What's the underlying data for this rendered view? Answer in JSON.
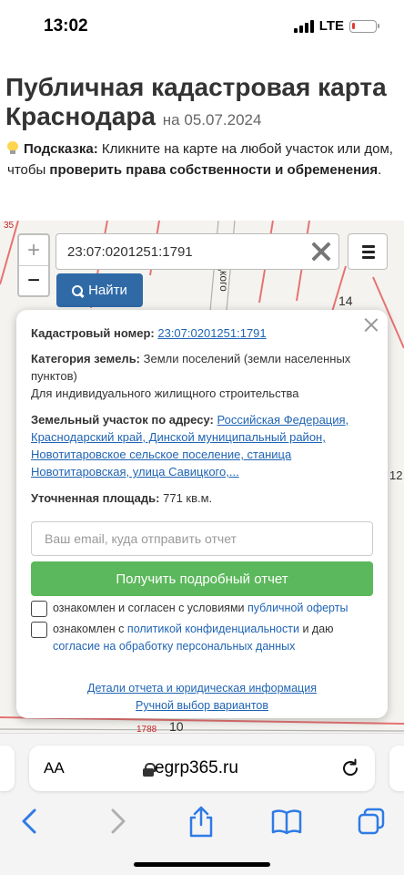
{
  "status_bar": {
    "time": "13:02",
    "network": "LTE",
    "battery_level": 0.15
  },
  "page": {
    "title": "Публичная кадастровая карта Краснодара",
    "date": "на 05.07.2024",
    "hint_label": "Подсказка:",
    "hint_text": "Кликните на карте на любой участок или дом, чтобы",
    "hint_bold": "проверить права собственности и обременения",
    "hint_end": "."
  },
  "map": {
    "labels": {
      "street": "цкого",
      "n14": "14",
      "n10": "10",
      "n1788": "1788",
      "n12": "12",
      "n35": "35"
    },
    "zoom_in_label": "+",
    "zoom_out_label": "−",
    "search_value": "23:07:0201251:1791",
    "find_button_label": "Найти"
  },
  "popup": {
    "cadastral_label": "Кадастровый номер:",
    "cadastral_value": "23:07:0201251:1791",
    "category_label": "Категория земель:",
    "category_value": "Земли поселений (земли населенных пунктов)",
    "usage": "Для индивидуального жилищного строительства",
    "address_label": "Земельный участок по адресу:",
    "address_value": "Российская Федерация, Краснодарский край, Динской муниципальный район, Новотитаровское сельское поселение, станица Новотитаровская, улица Савицкого,...",
    "area_label": "Уточненная площадь:",
    "area_value": "771 кв.м.",
    "email_placeholder": "Ваш email, куда отправить отчет",
    "report_button": "Получить подробный отчет",
    "agree1_text": "ознакомлен и согласен с условиями",
    "agree1_link": "публичной оферты",
    "agree2_text": "ознакомлен с",
    "agree2_link": "политикой конфиденциальности",
    "agree2_mid": "и даю",
    "agree2_link2": "согласие на обработку персональных данных",
    "details_link": "Детали отчета и юридическая информация",
    "manual_link": "Ручной выбор вариантов"
  },
  "browser": {
    "aa_label": "AA",
    "url": "egrp365.ru"
  },
  "colors": {
    "accent_blue": "#2f6aa7",
    "link": "#1f64b3",
    "report_green": "#5cb85c",
    "parcel_lines": "#e57373"
  }
}
